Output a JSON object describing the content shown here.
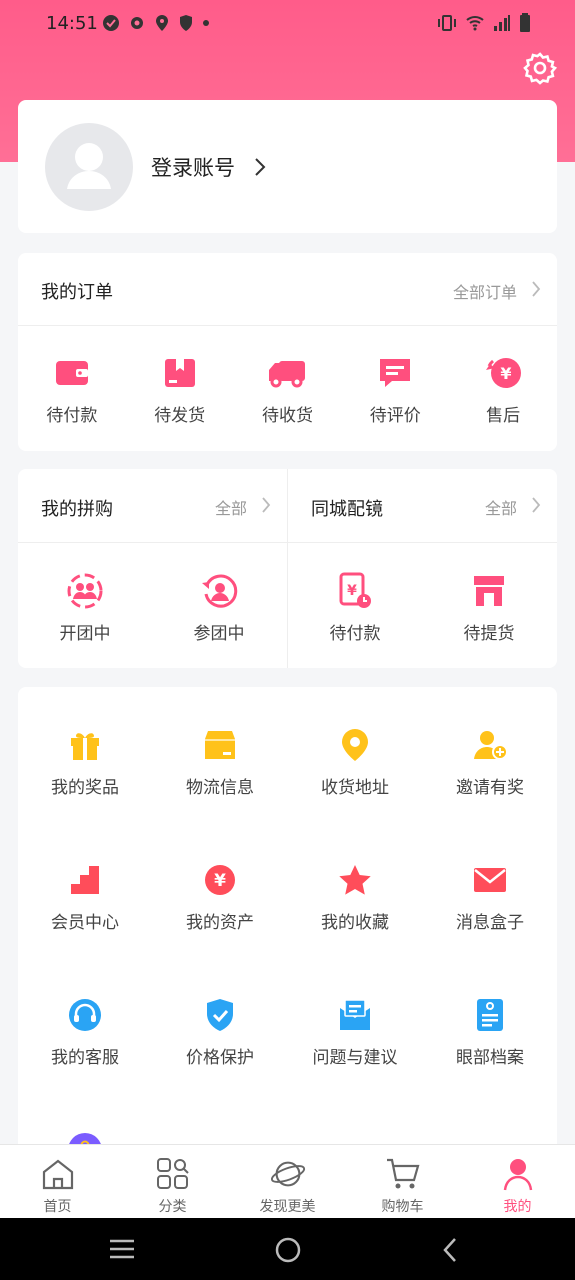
{
  "status_bar": {
    "time": "14:51"
  },
  "colors": {
    "brand": "#ff5c8a",
    "order_icon": "#ff4f7e",
    "service_yellow": "#ffc21a",
    "service_red": "#ff4d5a",
    "service_blue": "#2aa4f4",
    "active_tab": "#ff4f7e"
  },
  "profile": {
    "login_label": "登录账号"
  },
  "orders": {
    "title": "我的订单",
    "more": "全部订单",
    "items": [
      {
        "label": "待付款",
        "icon": "wallet-icon"
      },
      {
        "label": "待发货",
        "icon": "package-icon"
      },
      {
        "label": "待收货",
        "icon": "truck-icon"
      },
      {
        "label": "待评价",
        "icon": "comment-icon"
      },
      {
        "label": "售后",
        "icon": "refund-icon"
      }
    ]
  },
  "group_buy": {
    "title": "我的拼购",
    "more": "全部",
    "items": [
      {
        "label": "开团中",
        "icon": "group-start-icon"
      },
      {
        "label": "参团中",
        "icon": "group-join-icon"
      }
    ]
  },
  "local_glasses": {
    "title": "同城配镜",
    "more": "全部",
    "items": [
      {
        "label": "待付款",
        "icon": "bill-clock-icon"
      },
      {
        "label": "待提货",
        "icon": "store-icon"
      }
    ]
  },
  "services": [
    {
      "label": "我的奖品",
      "icon": "gift-icon"
    },
    {
      "label": "物流信息",
      "icon": "box-icon"
    },
    {
      "label": "收货地址",
      "icon": "location-pin-icon"
    },
    {
      "label": "邀请有奖",
      "icon": "add-user-icon"
    },
    {
      "label": "会员中心",
      "icon": "stairs-icon"
    },
    {
      "label": "我的资产",
      "icon": "yuan-coin-icon"
    },
    {
      "label": "我的收藏",
      "icon": "star-icon"
    },
    {
      "label": "消息盒子",
      "icon": "mail-icon"
    },
    {
      "label": "我的客服",
      "icon": "headset-icon"
    },
    {
      "label": "价格保护",
      "icon": "shield-check-icon"
    },
    {
      "label": "问题与建议",
      "icon": "feedback-icon"
    },
    {
      "label": "眼部档案",
      "icon": "file-icon"
    }
  ],
  "tabbar": [
    {
      "label": "首页",
      "icon": "home-icon"
    },
    {
      "label": "分类",
      "icon": "category-icon"
    },
    {
      "label": "发现更美",
      "icon": "planet-icon"
    },
    {
      "label": "购物车",
      "icon": "cart-icon"
    },
    {
      "label": "我的",
      "icon": "user-icon"
    }
  ]
}
